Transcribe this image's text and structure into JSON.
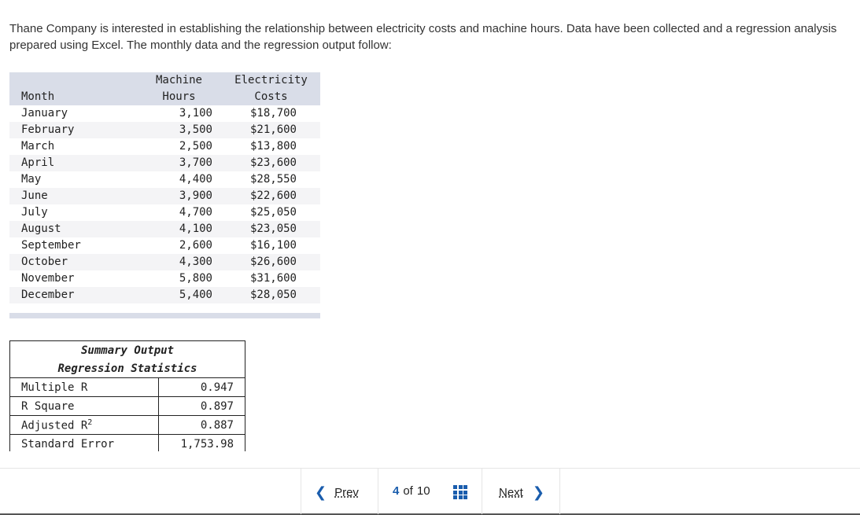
{
  "intro_text": "Thane Company is interested in establishing the relationship between electricity costs and machine hours. Data have been collected and a regression analysis prepared using Excel. The monthly data and the regression output follow:",
  "data_table": {
    "headers": {
      "month": "Month",
      "hours_line1": "Machine",
      "hours_line2": "Hours",
      "costs_line1": "Electricity",
      "costs_line2": "Costs"
    },
    "rows": [
      {
        "month": "January",
        "hours": "3,100",
        "costs": "$18,700"
      },
      {
        "month": "February",
        "hours": "3,500",
        "costs": "$21,600"
      },
      {
        "month": "March",
        "hours": "2,500",
        "costs": "$13,800"
      },
      {
        "month": "April",
        "hours": "3,700",
        "costs": "$23,600"
      },
      {
        "month": "May",
        "hours": "4,400",
        "costs": "$28,550"
      },
      {
        "month": "June",
        "hours": "3,900",
        "costs": "$22,600"
      },
      {
        "month": "July",
        "hours": "4,700",
        "costs": "$25,050"
      },
      {
        "month": "August",
        "hours": "4,100",
        "costs": "$23,050"
      },
      {
        "month": "September",
        "hours": "2,600",
        "costs": "$16,100"
      },
      {
        "month": "October",
        "hours": "4,300",
        "costs": "$26,600"
      },
      {
        "month": "November",
        "hours": "5,800",
        "costs": "$31,600"
      },
      {
        "month": "December",
        "hours": "5,400",
        "costs": "$28,050"
      }
    ]
  },
  "summary": {
    "title": "Summary Output",
    "subtitle": "Regression Statistics",
    "stats": [
      {
        "label": "Multiple R",
        "value": "0.947"
      },
      {
        "label": "R Square",
        "value": "0.897"
      },
      {
        "label": "Adjusted R",
        "sup": "2",
        "value": "0.887"
      },
      {
        "label": "Standard Error",
        "value": "1,753.98"
      }
    ]
  },
  "nav": {
    "prev_label": "Prev",
    "current_page": "4",
    "of_label": "of",
    "total_pages": "10",
    "next_label": "Next"
  },
  "colors": {
    "accent": "#1a5dad",
    "table_header_bg": "#d9dde8"
  }
}
